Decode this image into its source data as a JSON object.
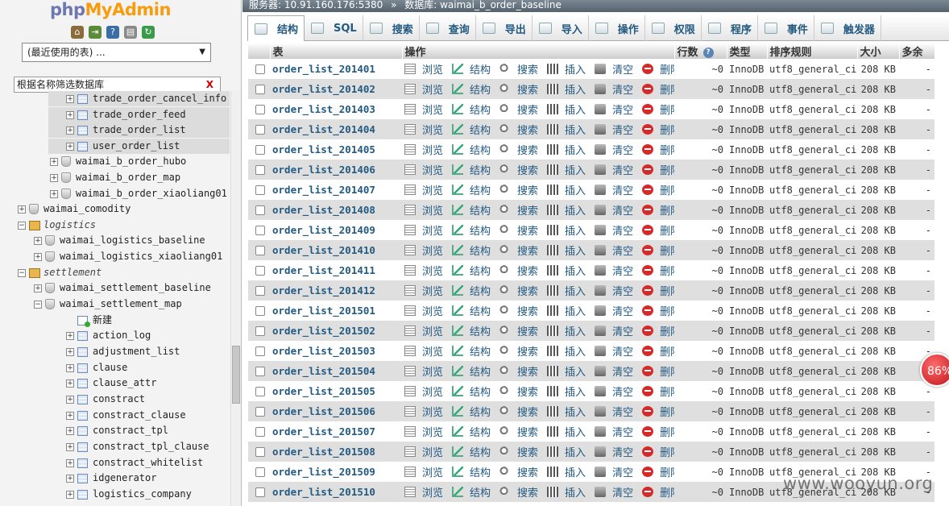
{
  "logo": {
    "php": "php",
    "my": "My",
    "admin": "Admin"
  },
  "left": {
    "recent_label": "(最近使用的表) ...",
    "filter_placeholder": "根据名称筛选数据库",
    "filter_clear": "X",
    "tree": [
      {
        "label": "trade_order_cancel_info",
        "kind": "table",
        "level": 3
      },
      {
        "label": "trade_order_feed",
        "kind": "table",
        "level": 3
      },
      {
        "label": "trade_order_list",
        "kind": "table",
        "level": 3
      },
      {
        "label": "user_order_list",
        "kind": "table",
        "level": 3
      },
      {
        "label": "waimai_b_order_hubo",
        "kind": "db",
        "level": 2
      },
      {
        "label": "waimai_b_order_map",
        "kind": "db",
        "level": 2
      },
      {
        "label": "waimai_b_order_xiaoliang01",
        "kind": "db",
        "level": 2
      },
      {
        "label": "waimai_comodity",
        "kind": "db",
        "level": 1
      },
      {
        "label": "logistics",
        "kind": "group",
        "level": 1
      },
      {
        "label": "waimai_logistics_baseline",
        "kind": "db",
        "level": 2
      },
      {
        "label": "waimai_logistics_xiaoliang01",
        "kind": "db",
        "level": 2
      },
      {
        "label": "settlement",
        "kind": "group",
        "level": 1
      },
      {
        "label": "waimai_settlement_baseline",
        "kind": "db",
        "level": 2
      },
      {
        "label": "waimai_settlement_map",
        "kind": "db-open",
        "level": 2
      },
      {
        "label": "新建",
        "kind": "new",
        "level": 3
      },
      {
        "label": "action_log",
        "kind": "table",
        "level": 3
      },
      {
        "label": "adjustment_list",
        "kind": "table",
        "level": 3
      },
      {
        "label": "clause",
        "kind": "table",
        "level": 3
      },
      {
        "label": "clause_attr",
        "kind": "table",
        "level": 3
      },
      {
        "label": "constract",
        "kind": "table",
        "level": 3
      },
      {
        "label": "constract_clause",
        "kind": "table",
        "level": 3
      },
      {
        "label": "constract_tpl",
        "kind": "table",
        "level": 3
      },
      {
        "label": "constract_tpl_clause",
        "kind": "table",
        "level": 3
      },
      {
        "label": "constract_whitelist",
        "kind": "table",
        "level": 3
      },
      {
        "label": "idgenerator",
        "kind": "table",
        "level": 3
      },
      {
        "label": "logistics_company",
        "kind": "table",
        "level": 3
      }
    ]
  },
  "breadcrumb": {
    "server": "服务器: 10.91.160.176:5380",
    "sep": "»",
    "database": "数据库: waimai_b_order_baseline"
  },
  "tabs": [
    {
      "label": "结构",
      "icon": "structure-icon",
      "active": true
    },
    {
      "label": "SQL",
      "icon": "sql-icon"
    },
    {
      "label": "搜索",
      "icon": "search-icon"
    },
    {
      "label": "查询",
      "icon": "query-icon"
    },
    {
      "label": "导出",
      "icon": "export-icon"
    },
    {
      "label": "导入",
      "icon": "import-icon"
    },
    {
      "label": "操作",
      "icon": "wrench-icon"
    },
    {
      "label": "权限",
      "icon": "privileges-icon"
    },
    {
      "label": "程序",
      "icon": "routines-icon"
    },
    {
      "label": "事件",
      "icon": "events-icon"
    },
    {
      "label": "触发器",
      "icon": "triggers-icon"
    }
  ],
  "table": {
    "headers": {
      "table": "表",
      "action": "操作",
      "rows": "行数",
      "type": "类型",
      "collation": "排序规则",
      "size": "大小",
      "overhead": "多余"
    },
    "actions": {
      "browse": "浏览",
      "structure": "结构",
      "search": "搜索",
      "insert": "插入",
      "empty": "清空",
      "drop": "删除"
    },
    "rows": [
      {
        "name": "order_list_201401",
        "rows": "~0",
        "type": "InnoDB",
        "collation": "utf8_general_ci",
        "size": "208 KB",
        "overhead": "-"
      },
      {
        "name": "order_list_201402",
        "rows": "~0",
        "type": "InnoDB",
        "collation": "utf8_general_ci",
        "size": "208 KB",
        "overhead": "-"
      },
      {
        "name": "order_list_201403",
        "rows": "~0",
        "type": "InnoDB",
        "collation": "utf8_general_ci",
        "size": "208 KB",
        "overhead": "-"
      },
      {
        "name": "order_list_201404",
        "rows": "~0",
        "type": "InnoDB",
        "collation": "utf8_general_ci",
        "size": "208 KB",
        "overhead": "-"
      },
      {
        "name": "order_list_201405",
        "rows": "~0",
        "type": "InnoDB",
        "collation": "utf8_general_ci",
        "size": "208 KB",
        "overhead": "-"
      },
      {
        "name": "order_list_201406",
        "rows": "~0",
        "type": "InnoDB",
        "collation": "utf8_general_ci",
        "size": "208 KB",
        "overhead": "-"
      },
      {
        "name": "order_list_201407",
        "rows": "~0",
        "type": "InnoDB",
        "collation": "utf8_general_ci",
        "size": "208 KB",
        "overhead": "-"
      },
      {
        "name": "order_list_201408",
        "rows": "~0",
        "type": "InnoDB",
        "collation": "utf8_general_ci",
        "size": "208 KB",
        "overhead": "-"
      },
      {
        "name": "order_list_201409",
        "rows": "~0",
        "type": "InnoDB",
        "collation": "utf8_general_ci",
        "size": "208 KB",
        "overhead": "-"
      },
      {
        "name": "order_list_201410",
        "rows": "~0",
        "type": "InnoDB",
        "collation": "utf8_general_ci",
        "size": "208 KB",
        "overhead": "-"
      },
      {
        "name": "order_list_201411",
        "rows": "~0",
        "type": "InnoDB",
        "collation": "utf8_general_ci",
        "size": "208 KB",
        "overhead": "-"
      },
      {
        "name": "order_list_201412",
        "rows": "~0",
        "type": "InnoDB",
        "collation": "utf8_general_ci",
        "size": "208 KB",
        "overhead": "-"
      },
      {
        "name": "order_list_201501",
        "rows": "~0",
        "type": "InnoDB",
        "collation": "utf8_general_ci",
        "size": "208 KB",
        "overhead": "-"
      },
      {
        "name": "order_list_201502",
        "rows": "~0",
        "type": "InnoDB",
        "collation": "utf8_general_ci",
        "size": "208 KB",
        "overhead": "-"
      },
      {
        "name": "order_list_201503",
        "rows": "~0",
        "type": "InnoDB",
        "collation": "utf8_general_ci",
        "size": "208 KB",
        "overhead": "-"
      },
      {
        "name": "order_list_201504",
        "rows": "~0",
        "type": "InnoDB",
        "collation": "utf8_general_ci",
        "size": "208 KB",
        "overhead": "-"
      },
      {
        "name": "order_list_201505",
        "rows": "~0",
        "type": "InnoDB",
        "collation": "utf8_general_ci",
        "size": "208 KB",
        "overhead": "-"
      },
      {
        "name": "order_list_201506",
        "rows": "~0",
        "type": "InnoDB",
        "collation": "utf8_general_ci",
        "size": "208 KB",
        "overhead": "-"
      },
      {
        "name": "order_list_201507",
        "rows": "~0",
        "type": "InnoDB",
        "collation": "utf8_general_ci",
        "size": "208 KB",
        "overhead": "-"
      },
      {
        "name": "order_list_201508",
        "rows": "~0",
        "type": "InnoDB",
        "collation": "utf8_general_ci",
        "size": "208 KB",
        "overhead": "-"
      },
      {
        "name": "order_list_201509",
        "rows": "~0",
        "type": "InnoDB",
        "collation": "utf8_general_ci",
        "size": "208 KB",
        "overhead": "-"
      },
      {
        "name": "order_list_201510",
        "rows": "~0",
        "type": "InnoDB",
        "collation": "utf8_general_ci",
        "size": "208 KB",
        "overhead": "-"
      }
    ]
  },
  "badge": "86%",
  "watermark": "www.wooyun.org",
  "colors": {
    "link": "#235a81",
    "logo_php": "#6c78af",
    "logo_myadmin": "#f89c0e",
    "badge": "#c0141a"
  }
}
